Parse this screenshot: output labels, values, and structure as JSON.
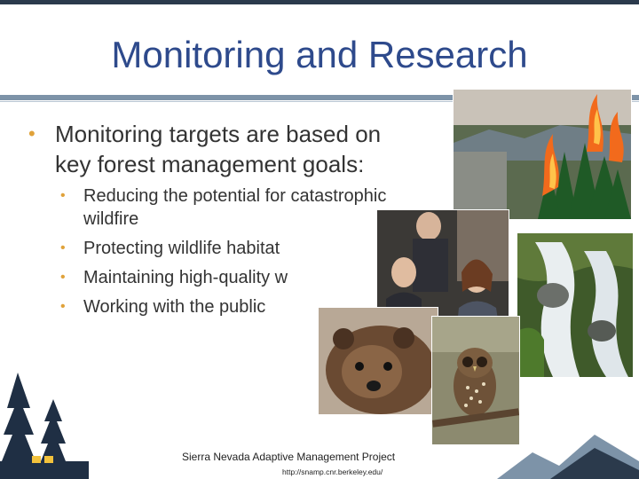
{
  "slide": {
    "title": "Monitoring and Research",
    "main_bullet": "Monitoring targets are based on key forest management goals:",
    "sub_bullets": [
      "Reducing the potential for catastrophic wildfire",
      "Protecting wildlife habitat",
      "Maintaining high-quality w",
      "Working with the public"
    ],
    "footer": {
      "project": "Sierra Nevada Adaptive Management Project",
      "url": "http://snamp.cnr.berkeley.edu/"
    }
  },
  "colors": {
    "title": "#2e4a8c",
    "bullet": "#e0a23a",
    "rule": "#7d93a8"
  },
  "images": [
    {
      "name": "forest-fire-photo",
      "icon": "wildfire"
    },
    {
      "name": "people-meeting-photo",
      "icon": "people"
    },
    {
      "name": "waterfall-photo",
      "icon": "water"
    },
    {
      "name": "fisher-animal-photo",
      "icon": "fisher"
    },
    {
      "name": "spotted-owl-photo",
      "icon": "owl"
    }
  ]
}
